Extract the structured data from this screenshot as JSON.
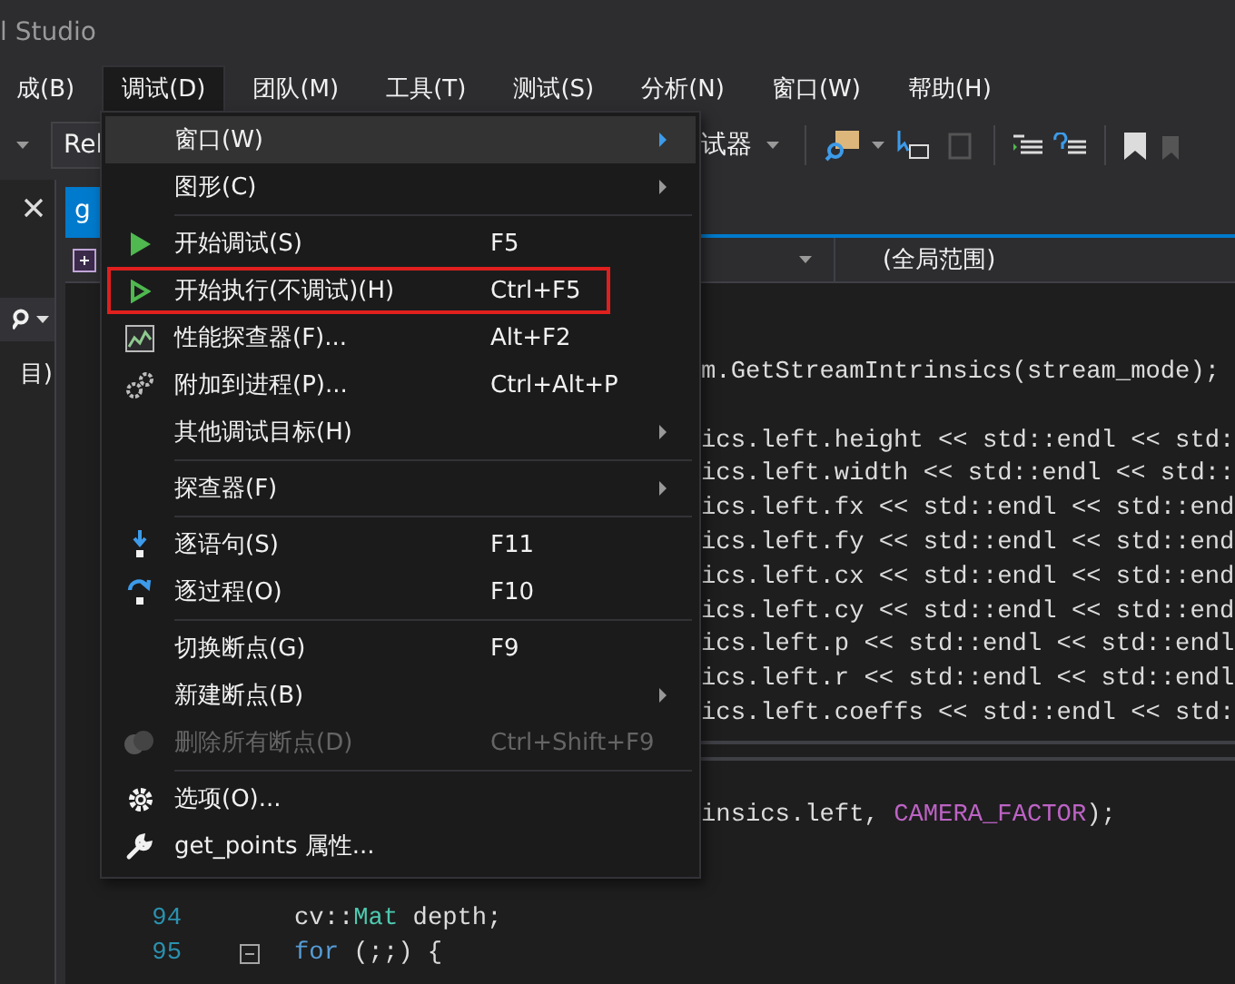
{
  "window": {
    "title": "l Studio"
  },
  "menu_bar": [
    {
      "label": "成(B)",
      "selected": false
    },
    {
      "label": "调试(D)",
      "selected": true
    },
    {
      "label": "团队(M)",
      "selected": false
    },
    {
      "label": "工具(T)",
      "selected": false
    },
    {
      "label": "测试(S)",
      "selected": false
    },
    {
      "label": "分析(N)",
      "selected": false
    },
    {
      "label": "窗口(W)",
      "selected": false
    },
    {
      "label": "帮助(H)",
      "selected": false
    }
  ],
  "toolbar": {
    "config_combo": "Rel",
    "debugger_combo": "试器"
  },
  "side_panel": {
    "text": "目)"
  },
  "document_tab": {
    "label": "g",
    "selected": true
  },
  "nav_bar": {
    "scope": "(全局范围)"
  },
  "editor": {
    "lines": [
      {
        "kind": "fragment",
        "segments": [
          {
            "kind": "plain",
            "text": "m.GetStreamIntrinsics(stream_mode);"
          }
        ]
      },
      {
        "kind": "blank"
      },
      {
        "kind": "fragment",
        "segments": [
          {
            "kind": "plain",
            "text": "ics.left.height << std::endl << std:"
          }
        ]
      },
      {
        "kind": "fragment",
        "segments": [
          {
            "kind": "plain",
            "text": "ics.left.width << std::endl << std::"
          }
        ]
      },
      {
        "kind": "fragment",
        "segments": [
          {
            "kind": "plain",
            "text": "ics.left.fx << std::endl << std::end"
          }
        ]
      },
      {
        "kind": "fragment",
        "segments": [
          {
            "kind": "plain",
            "text": "ics.left.fy << std::endl << std::end"
          }
        ]
      },
      {
        "kind": "fragment",
        "segments": [
          {
            "kind": "plain",
            "text": "ics.left.cx << std::endl << std::end"
          }
        ]
      },
      {
        "kind": "fragment",
        "segments": [
          {
            "kind": "plain",
            "text": "ics.left.cy << std::endl << std::end"
          }
        ]
      },
      {
        "kind": "fragment",
        "segments": [
          {
            "kind": "plain",
            "text": "ics.left.p << std::endl << std::endl"
          }
        ]
      },
      {
        "kind": "fragment",
        "segments": [
          {
            "kind": "plain",
            "text": "ics.left.r << std::endl << std::endl"
          }
        ]
      },
      {
        "kind": "fragment",
        "segments": [
          {
            "kind": "plain",
            "text": "ics.left.coeffs << std::endl << std:"
          }
        ]
      },
      {
        "kind": "divider"
      },
      {
        "kind": "blank"
      },
      {
        "kind": "fragment",
        "segments": [
          {
            "kind": "plain",
            "text": "insics.left, "
          },
          {
            "kind": "macro",
            "text": "CAMERA_FACTOR"
          },
          {
            "kind": "plain",
            "text": ");"
          }
        ]
      },
      {
        "kind": "blank"
      },
      {
        "kind": "blank"
      },
      {
        "kind": "numbered",
        "number": "94",
        "foldable": false,
        "segments": [
          {
            "kind": "plain",
            "text": "cv::"
          },
          {
            "kind": "type",
            "text": "Mat"
          },
          {
            "kind": "plain",
            "text": " depth;"
          }
        ]
      },
      {
        "kind": "numbered",
        "number": "95",
        "foldable": true,
        "segments": [
          {
            "kind": "keyword",
            "text": "for"
          },
          {
            "kind": "plain",
            "text": " (;;) {"
          }
        ]
      }
    ]
  },
  "menu": {
    "items": [
      {
        "kind": "item",
        "label": "窗口(W)",
        "submenu": true,
        "highlighted": true,
        "disabled": false,
        "outlined": false
      },
      {
        "kind": "item",
        "label": "图形(C)",
        "submenu": true,
        "highlighted": false,
        "disabled": false,
        "outlined": false
      },
      {
        "kind": "separator"
      },
      {
        "kind": "item",
        "label": "开始调试(S)",
        "shortcut": "F5",
        "submenu": false,
        "highlighted": false,
        "disabled": false,
        "outlined": false
      },
      {
        "kind": "item",
        "label": "开始执行(不调试)(H)",
        "shortcut": "Ctrl+F5",
        "submenu": false,
        "highlighted": false,
        "disabled": false,
        "outlined": true
      },
      {
        "kind": "item",
        "label": "性能探查器(F)...",
        "shortcut": "Alt+F2",
        "submenu": false,
        "highlighted": false,
        "disabled": false,
        "outlined": false
      },
      {
        "kind": "item",
        "label": "附加到进程(P)...",
        "shortcut": "Ctrl+Alt+P",
        "submenu": false,
        "highlighted": false,
        "disabled": false,
        "outlined": false
      },
      {
        "kind": "item",
        "label": "其他调试目标(H)",
        "submenu": true,
        "highlighted": false,
        "disabled": false,
        "outlined": false
      },
      {
        "kind": "separator"
      },
      {
        "kind": "item",
        "label": "探查器(F)",
        "submenu": true,
        "highlighted": false,
        "disabled": false,
        "outlined": false
      },
      {
        "kind": "separator"
      },
      {
        "kind": "item",
        "label": "逐语句(S)",
        "shortcut": "F11",
        "submenu": false,
        "highlighted": false,
        "disabled": false,
        "outlined": false
      },
      {
        "kind": "item",
        "label": "逐过程(O)",
        "shortcut": "F10",
        "submenu": false,
        "highlighted": false,
        "disabled": false,
        "outlined": false
      },
      {
        "kind": "separator"
      },
      {
        "kind": "item",
        "label": "切换断点(G)",
        "shortcut": "F9",
        "submenu": false,
        "highlighted": false,
        "disabled": false,
        "outlined": false
      },
      {
        "kind": "item",
        "label": "新建断点(B)",
        "submenu": true,
        "highlighted": false,
        "disabled": false,
        "outlined": false
      },
      {
        "kind": "item",
        "label": "删除所有断点(D)",
        "shortcut": "Ctrl+Shift+F9",
        "submenu": false,
        "highlighted": false,
        "disabled": true,
        "outlined": false
      },
      {
        "kind": "separator"
      },
      {
        "kind": "item",
        "label": "选项(O)...",
        "submenu": false,
        "highlighted": false,
        "disabled": false,
        "outlined": false
      },
      {
        "kind": "item",
        "label": "get_points 属性...",
        "submenu": false,
        "highlighted": false,
        "disabled": false,
        "outlined": false
      }
    ]
  }
}
